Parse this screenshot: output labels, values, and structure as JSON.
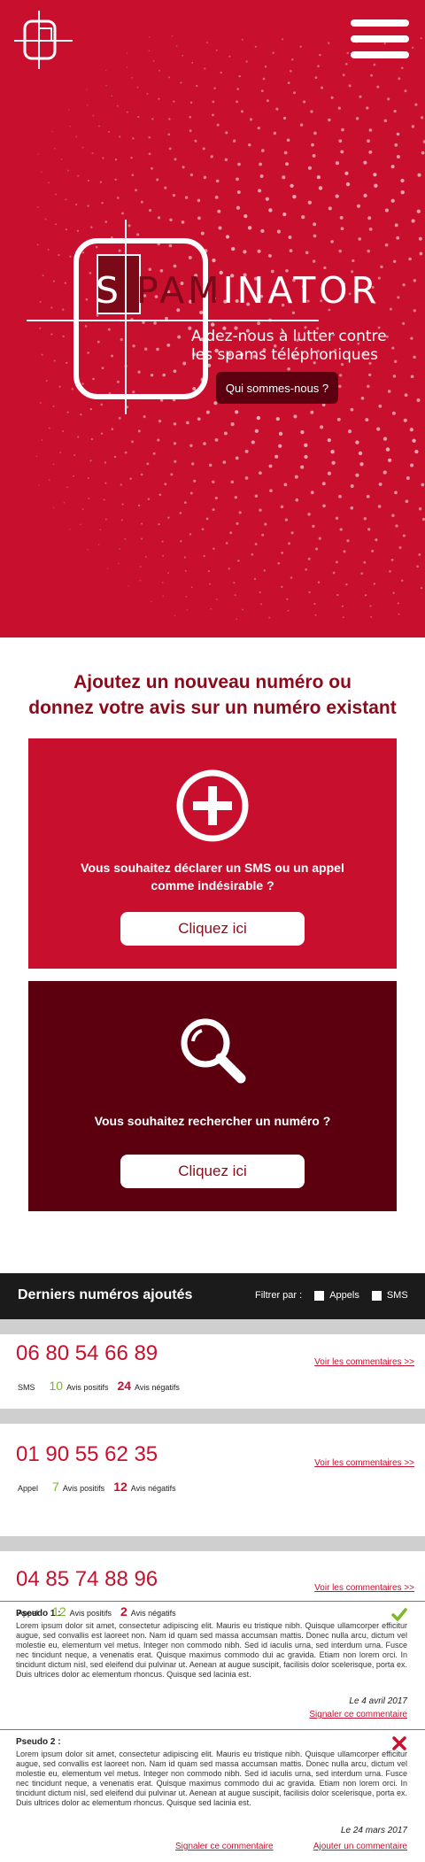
{
  "header": {
    "logo": "logo-icon",
    "menu": "hamburger-menu-icon"
  },
  "hero": {
    "brand_initial": "S",
    "brand_mid": "PAM",
    "brand_rest": "INATOR",
    "subtitle_line1": "Aidez-nous à lutter contre",
    "subtitle_line2": "les spams téléphoniques",
    "about_label": "Qui sommes-nous ?"
  },
  "intro": {
    "title_line1": "Ajoutez un nouveau numéro ou",
    "title_line2": "donnez votre avis sur un numéro existant"
  },
  "cards": [
    {
      "icon": "plus-circle-icon",
      "question_line1": "Vous souhaitez déclarer un SMS ou un appel",
      "question_line2": "comme indésirable ?",
      "cta": "Cliquez ici"
    },
    {
      "icon": "magnifier-icon",
      "question_line1": "Vous souhaitez rechercher un numéro ?",
      "cta": "Cliquez ici"
    }
  ],
  "colors": {
    "brand_red": "#c8102e",
    "dark_red": "#5c0010",
    "positive_green": "#7ab928"
  },
  "list": {
    "title": "Derniers numéros ajoutés",
    "filter_label": "Filtrer par :",
    "filter_options": [
      "Appels",
      "SMS"
    ],
    "entries": [
      {
        "number": "06 80 54 66 89",
        "type": "SMS",
        "pos": "10",
        "pos_label": "Avis positifs",
        "neg": "24",
        "neg_label": "Avis négatifs",
        "link": "Voir les commentaires >>"
      },
      {
        "number": "01 90 55 62 35",
        "type": "Appel",
        "pos": "7",
        "pos_label": "Avis positifs",
        "neg": "12",
        "neg_label": "Avis négatifs",
        "link": "Voir les commentaires >>"
      },
      {
        "number": "04 85 74 88 96",
        "type": "Appel",
        "pos": "12",
        "pos_label": "Avis positifs",
        "neg": "2",
        "neg_label": "Avis négatifs",
        "link": "Voir les commentaires >>"
      }
    ]
  },
  "comments": [
    {
      "author": "Pseudo 1 :",
      "status": "check-icon",
      "text": "Lorem ipsum dolor sit amet, consectetur adipiscing elit. Mauris eu tristique nibh. Quisque ullamcorper efficitur augue, sed convallis est laoreet non. Nam id quam sed massa accumsan mattis. Donec nulla arcu, dictum vel molestie eu, elementum vel metus. Integer non commodo nibh. Sed id iaculis urna, sed interdum urna. Fusce nec tincidunt neque, a venenatis erat. Quisque maximus commodo dui ac gravida. Etiam non lorem orci. In tincidunt dictum nisl, sed eleifend dui pulvinar ut. Aenean at augue suscipit, facilisis dolor scelerisque, porta ex. Duis ultrices dolor ac elementum rhoncus. Quisque sed lacinia est.",
      "date": "Le 4 avril 2017",
      "report": "Signaler ce commentaire"
    },
    {
      "author": "Pseudo 2 :",
      "status": "cross-icon",
      "text": "Lorem ipsum dolor sit amet, consectetur adipiscing elit. Mauris eu tristique nibh. Quisque ullamcorper efficitur augue, sed convallis est laoreet non. Nam id quam sed massa accumsan mattis. Donec nulla arcu, dictum vel molestie eu, elementum vel metus. Integer non commodo nibh. Sed id iaculis urna, sed interdum urna. Fusce nec tincidunt neque, a venenatis erat. Quisque maximus commodo dui ac gravida. Etiam non lorem orci. In tincidunt dictum nisl, sed eleifend dui pulvinar ut. Aenean at augue suscipit, facilisis dolor scelerisque, porta ex. Duis ultrices dolor ac elementum rhoncus. Quisque sed lacinia est.",
      "date": "Le 24 mars 2017",
      "report": "Signaler ce commentaire",
      "add": "Ajouter un commentaire"
    }
  ]
}
